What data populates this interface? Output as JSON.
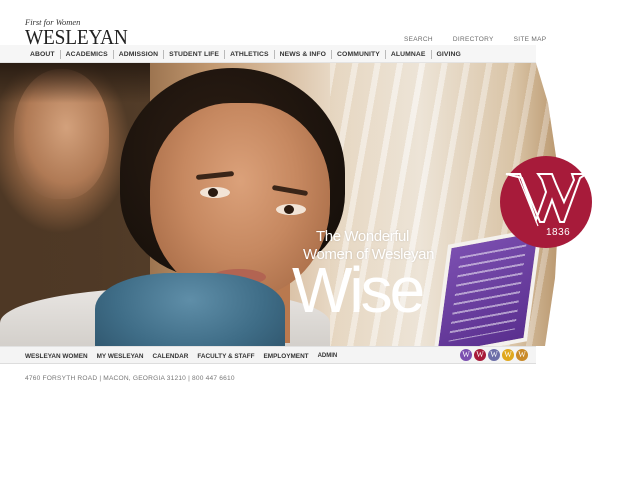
{
  "brand": {
    "tagline": "First for Women",
    "name": "WESLEYAN"
  },
  "utility_links": [
    "SEARCH",
    "DIRECTORY",
    "SITE MAP"
  ],
  "main_nav": [
    "ABOUT",
    "ACADEMICS",
    "ADMISSION",
    "STUDENT LIFE",
    "ATHLETICS",
    "NEWS & INFO",
    "COMMUNITY",
    "ALUMNAE",
    "GIVING"
  ],
  "hero": {
    "line1": "The Wonderful",
    "line2": "Women of Wesleyan",
    "headline": "Wise",
    "seal_letter": "W",
    "seal_year": "1836"
  },
  "lower_nav": [
    "WESLEYAN WOMEN",
    "MY WESLEYAN",
    "CALENDAR",
    "FACULTY & STAFF",
    "EMPLOYMENT",
    "ADMIN"
  ],
  "w_circles": [
    {
      "letter": "W",
      "color": "#7b4fb0",
      "icon": "w-circle-icon"
    },
    {
      "letter": "W",
      "color": "#a71b3a",
      "icon": "w-circle-icon"
    },
    {
      "letter": "W",
      "color": "#6d6fa8",
      "icon": "w-circle-icon"
    },
    {
      "letter": "W",
      "color": "#e0a81e",
      "icon": "w-circle-icon"
    },
    {
      "letter": "W",
      "color": "#c98a2a",
      "icon": "w-circle-icon"
    }
  ],
  "footer": {
    "address": "4760 FORSYTH ROAD | MACON, GEORGIA 31210 | 800 447 6610"
  },
  "colors": {
    "accent": "#a71b3a",
    "nav_bg": "#f6f6f6"
  }
}
